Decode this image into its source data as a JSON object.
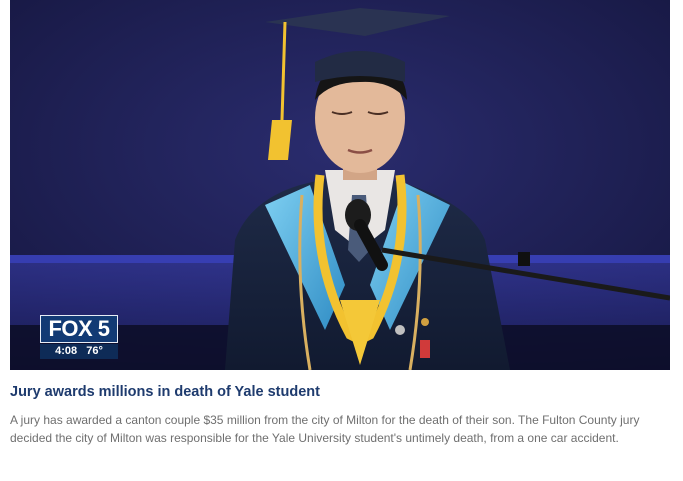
{
  "video": {
    "station_logo": "FOX 5",
    "time": "4:08",
    "temperature": "76°",
    "thumbnail_subject": "graduate-speaking-at-podium"
  },
  "article": {
    "headline": "Jury awards millions in death of Yale student",
    "summary": "A jury has awarded a canton couple $35 million from the city of Milton for the death of their son. The Fulton County jury decided the city of Milton was responsible for the Yale University student's untimely death, from a one car accident."
  },
  "colors": {
    "headline": "#1e3b6e",
    "summary": "#6f6f6f",
    "background": "#ffffff",
    "logo_blue": "#123a74"
  }
}
